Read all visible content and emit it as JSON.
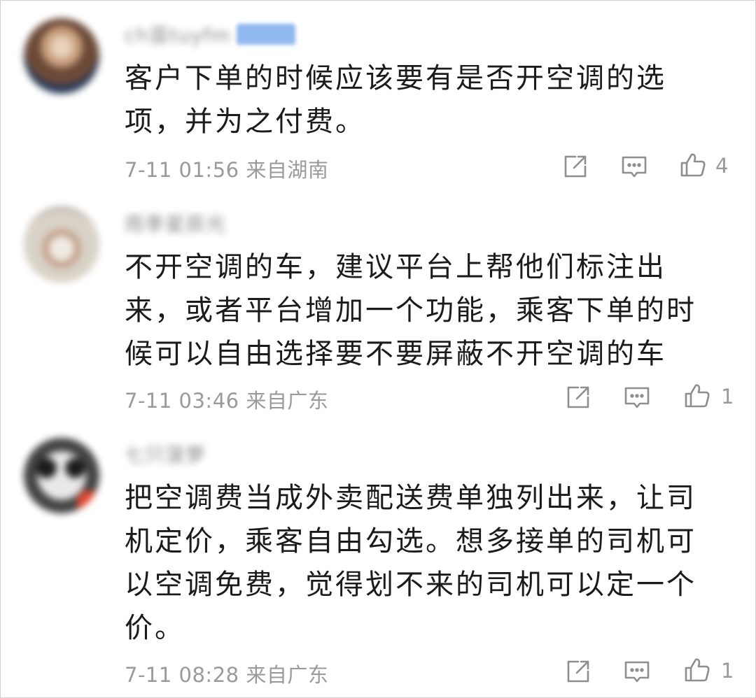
{
  "comments": [
    {
      "username": "ch苗tuyfm",
      "avatar_colors": [
        "#6d4a38",
        "#c9a07e",
        "#2a3b57",
        "#e8d2bb"
      ],
      "text": "客户下单的时候应该要有是否开空调的选项，并为之付费。",
      "time": "7-11 01:56",
      "location": "来自湖南",
      "likes": "4"
    },
    {
      "username": "雨季星辰光",
      "avatar_colors": [
        "#d9d2c7",
        "#c29f8a",
        "#f0ebe3",
        "#8a7f76"
      ],
      "text": "不开空调的车，建议平台上帮他们标注出来，或者平台增加一个功能，乘客下单的时候可以自由选择要不要屏蔽不开空调的车",
      "time": "7-11 03:46",
      "location": "来自广东",
      "likes": "1"
    },
    {
      "username": "七只菠萝",
      "avatar_colors": [
        "#1c1c1c",
        "#e9e9e9",
        "#444444",
        "#e0442c"
      ],
      "text": "把空调费当成外卖配送费单独列出来，让司机定价，乘客自由勾选。想多接单的司机可以空调免费，觉得划不来的司机可以定一个价。",
      "time": "7-11 08:28",
      "location": "来自广东",
      "likes": "1"
    }
  ],
  "icons": {
    "share": "share-icon",
    "reply": "comment-icon",
    "like": "thumbs-up-icon"
  },
  "colors": {
    "text": "#1b1b1b",
    "meta": "#9a9a9a",
    "icon": "#8e8e8e",
    "badge": "#8fb8ee"
  }
}
